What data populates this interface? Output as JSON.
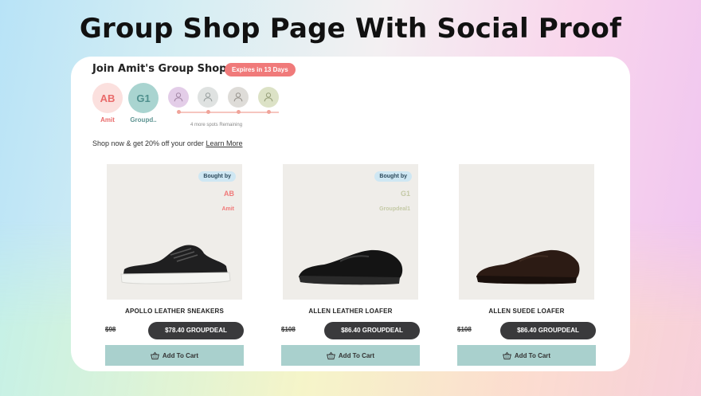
{
  "page": {
    "heading": "Group Shop Page With Social Proof"
  },
  "group_shop": {
    "title": "Join Amit's Group Shop",
    "expires_badge": "Expires in 13 Days",
    "members": [
      {
        "initials": "AB",
        "name": "Amit"
      },
      {
        "initials": "G1",
        "name": "Groupd.."
      }
    ],
    "empty_slots": [
      {
        "color": "#e3cde8"
      },
      {
        "color": "#dfe2e1"
      },
      {
        "color": "#dedcd8"
      },
      {
        "color": "#dce2c6"
      }
    ],
    "spots_remaining_text": "4 more spots Remaining",
    "promo_text": "Shop now & get 20% off your order",
    "learn_more": "Learn More"
  },
  "products": [
    {
      "title": "APOLLO LEATHER SNEAKERS",
      "old_price": "$98",
      "deal_label": "$78.40 GROUPDEAL",
      "add_to_cart": "Add To Cart",
      "bought_by_label": "Bought by",
      "buyer_initials": "AB",
      "buyer_name": "Amit"
    },
    {
      "title": "ALLEN LEATHER LOAFER",
      "old_price": "$108",
      "deal_label": "$86.40 GROUPDEAL",
      "add_to_cart": "Add To Cart",
      "bought_by_label": "Bought by",
      "buyer_initials": "G1",
      "buyer_name": "Groupdeal1"
    },
    {
      "title": "ALLEN SUEDE LOAFER",
      "old_price": "$108",
      "deal_label": "$86.40 GROUPDEAL",
      "add_to_cart": "Add To Cart"
    }
  ],
  "colors": {
    "accent_red": "#f07a7a",
    "cart_button": "#a9d0cd",
    "deal_pill": "#3a3a3c"
  }
}
